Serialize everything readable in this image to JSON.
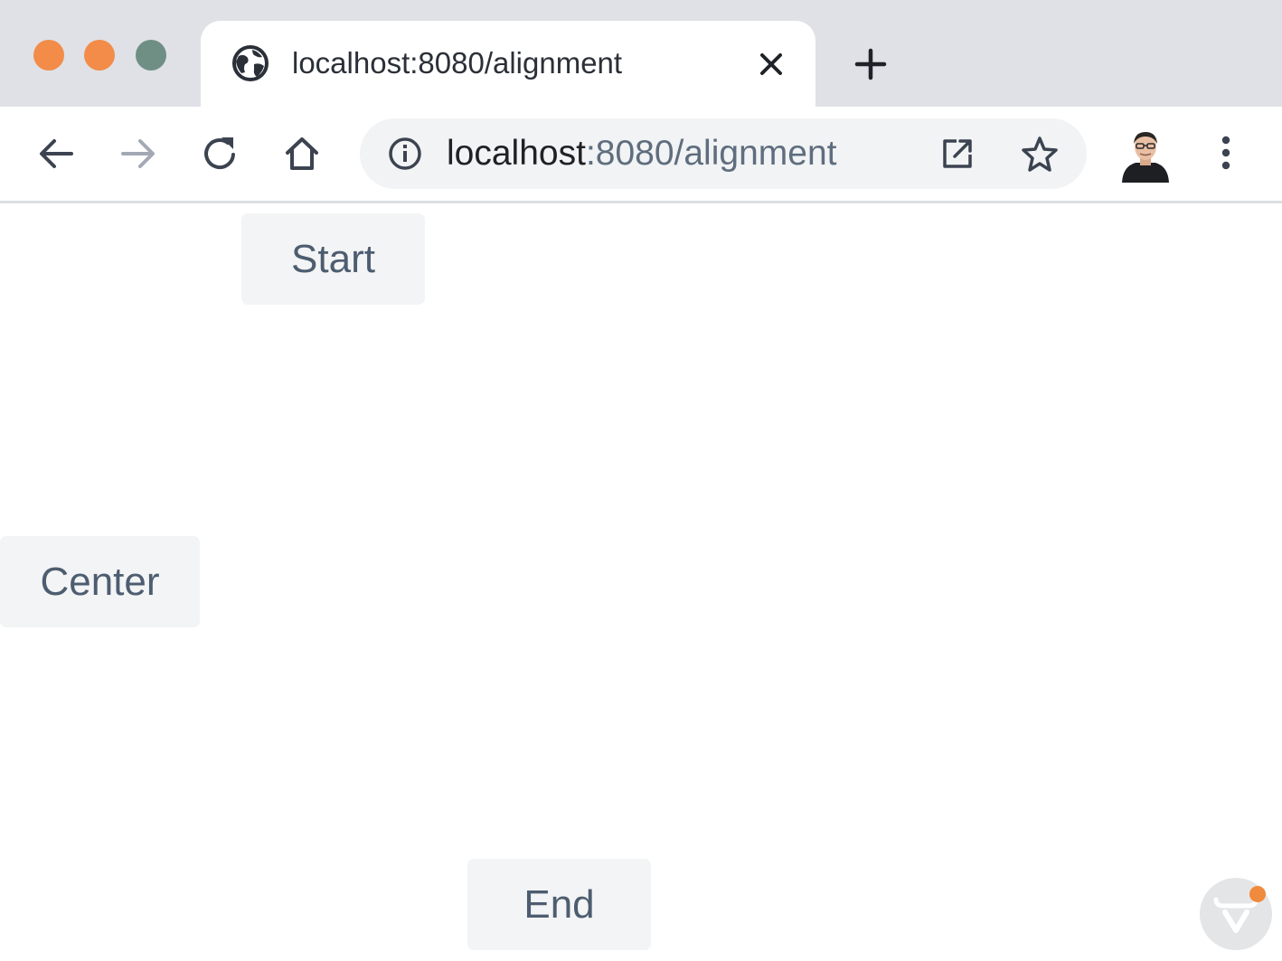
{
  "colors": {
    "traffic_close": "#f28c48",
    "traffic_minimize": "#f28c48",
    "traffic_maximize": "#6f8f85",
    "tab_strip_bg": "#dfe1e6",
    "button_bg": "#f3f4f5",
    "button_text": "#4d5d70",
    "devtools_badge": "#f08a3c"
  },
  "browser": {
    "tab": {
      "title": "localhost:8080/alignment",
      "favicon": "globe-icon",
      "close_icon": "close-icon"
    },
    "new_tab_icon": "plus-icon",
    "toolbar": {
      "back_icon": "arrow-left-icon",
      "forward_icon": "arrow-right-icon",
      "reload_icon": "reload-icon",
      "home_icon": "home-icon",
      "address": {
        "info_icon": "info-icon",
        "host": "localhost",
        "path": ":8080/alignment",
        "open_icon": "open-external-icon",
        "bookmark_icon": "star-icon"
      },
      "profile_icon": "avatar",
      "menu_icon": "kebab-menu-icon"
    }
  },
  "page": {
    "buttons": {
      "start": "Start",
      "center": "Center",
      "end": "End"
    },
    "devtools_icon": "vaadin-devtools-icon"
  }
}
